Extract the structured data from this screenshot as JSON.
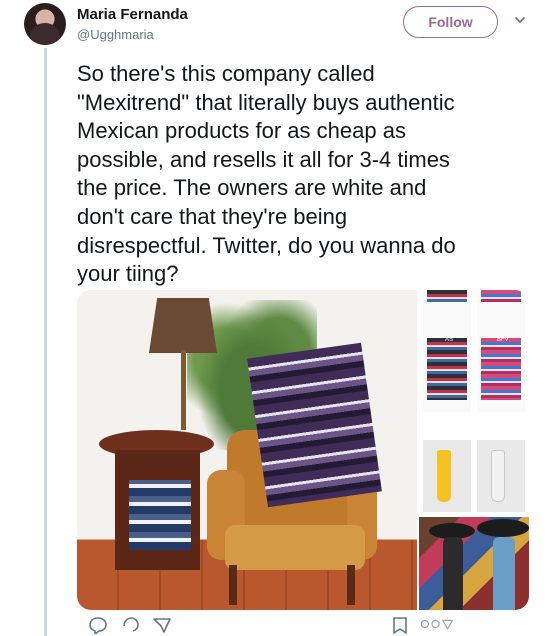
{
  "author": {
    "name": "Maria Fernanda",
    "handle": "@Ugghmaria",
    "follow_label": "Follow"
  },
  "tweet": {
    "text": "So there's this company called\n\"Mexitrend\" that literally buys authentic\nMexican products for as cheap as\npossible, and resells it all for 3-4 times\nthe price. The owners are white and\ndon't care that they're being\ndisrespectful. Twitter, do you wanna do\nyour tiing?"
  },
  "media": {
    "product_labels": {
      "row1_left_badge": "AS",
      "row1_right_badge": "BFV"
    }
  },
  "icons": {
    "caret": "chevron-down-icon",
    "reply": "reply-icon",
    "comment": "comment-icon",
    "share": "share-icon",
    "bookmark": "bookmark-icon"
  },
  "colors": {
    "accent": "#9c6b8f",
    "text": "#14171a",
    "secondary_text": "#657786",
    "thread_line": "#ccd6dd"
  }
}
